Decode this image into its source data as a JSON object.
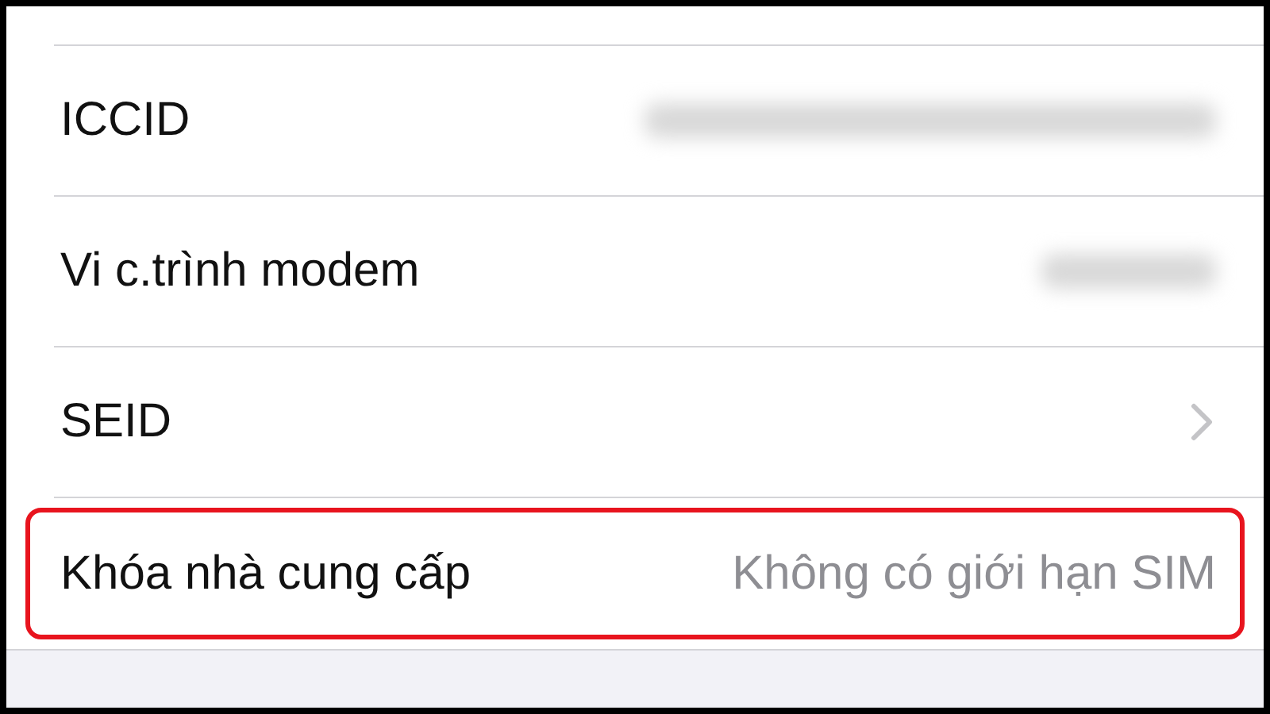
{
  "rows": [
    {
      "label": "ICCID",
      "kind": "blurred",
      "highlighted": false
    },
    {
      "label": "Vi c.trình modem",
      "kind": "blurred",
      "highlighted": false
    },
    {
      "label": "SEID",
      "kind": "link",
      "highlighted": false
    },
    {
      "label": "Khóa nhà cung cấp",
      "kind": "value",
      "value": "Không có giới hạn SIM",
      "highlighted": true
    }
  ]
}
